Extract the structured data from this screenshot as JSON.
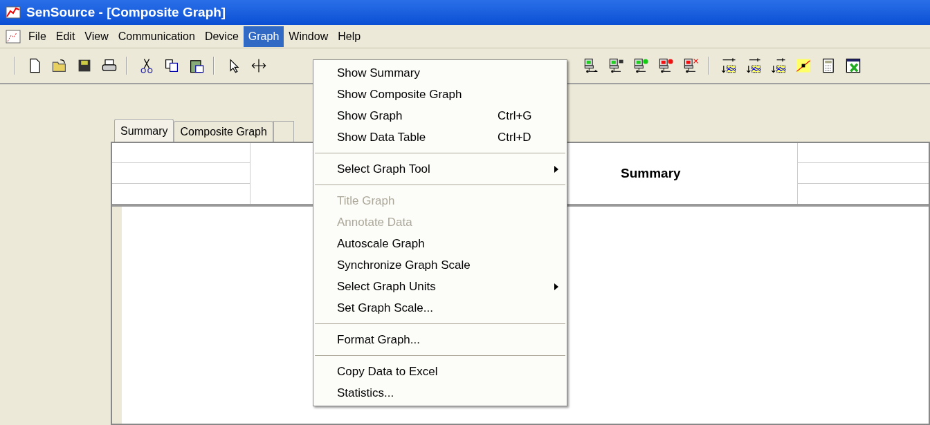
{
  "window": {
    "title": "SenSource - [Composite Graph]"
  },
  "menubar": [
    {
      "label": "File",
      "selected": false
    },
    {
      "label": "Edit",
      "selected": false
    },
    {
      "label": "View",
      "selected": false
    },
    {
      "label": "Communication",
      "selected": false
    },
    {
      "label": "Device",
      "selected": false
    },
    {
      "label": "Graph",
      "selected": true
    },
    {
      "label": "Window",
      "selected": false
    },
    {
      "label": "Help",
      "selected": false
    }
  ],
  "tabs": [
    {
      "label": "Summary",
      "selected": true
    },
    {
      "label": "Composite Graph",
      "selected": false
    }
  ],
  "summary_header": {
    "title": "Summary"
  },
  "graph_menu": [
    {
      "kind": "item",
      "label": "Show Summary",
      "disabled": false
    },
    {
      "kind": "item",
      "label": "Show Composite Graph",
      "disabled": false
    },
    {
      "kind": "item",
      "label": "Show Graph",
      "shortcut": "Ctrl+G",
      "disabled": false
    },
    {
      "kind": "item",
      "label": "Show Data Table",
      "shortcut": "Ctrl+D",
      "disabled": false
    },
    {
      "kind": "separator"
    },
    {
      "kind": "item",
      "label": "Select Graph Tool",
      "submenu": true,
      "disabled": false
    },
    {
      "kind": "separator"
    },
    {
      "kind": "item",
      "label": "Title Graph",
      "disabled": true
    },
    {
      "kind": "item",
      "label": "Annotate Data",
      "disabled": true
    },
    {
      "kind": "item",
      "label": "Autoscale Graph",
      "disabled": false
    },
    {
      "kind": "item",
      "label": "Synchronize Graph Scale",
      "disabled": false
    },
    {
      "kind": "item",
      "label": "Select Graph Units",
      "submenu": true,
      "disabled": false
    },
    {
      "kind": "item",
      "label": "Set Graph Scale...",
      "disabled": false
    },
    {
      "kind": "separator"
    },
    {
      "kind": "item",
      "label": "Format Graph...",
      "disabled": false
    },
    {
      "kind": "separator"
    },
    {
      "kind": "item",
      "label": "Copy Data to Excel",
      "disabled": false
    },
    {
      "kind": "item",
      "label": "Statistics...",
      "disabled": false
    }
  ]
}
